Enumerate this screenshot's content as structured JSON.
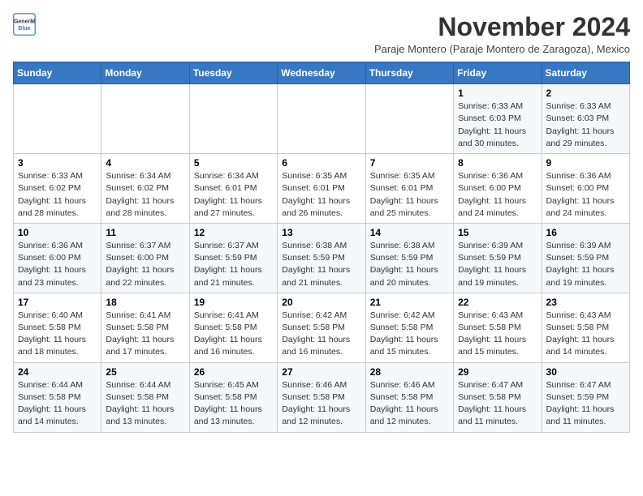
{
  "header": {
    "logo_line1": "General",
    "logo_line2": "Blue",
    "month_title": "November 2024",
    "subtitle": "Paraje Montero (Paraje Montero de Zaragoza), Mexico"
  },
  "days_of_week": [
    "Sunday",
    "Monday",
    "Tuesday",
    "Wednesday",
    "Thursday",
    "Friday",
    "Saturday"
  ],
  "weeks": [
    [
      {
        "day": "",
        "info": ""
      },
      {
        "day": "",
        "info": ""
      },
      {
        "day": "",
        "info": ""
      },
      {
        "day": "",
        "info": ""
      },
      {
        "day": "",
        "info": ""
      },
      {
        "day": "1",
        "info": "Sunrise: 6:33 AM\nSunset: 6:03 PM\nDaylight: 11 hours and 30 minutes."
      },
      {
        "day": "2",
        "info": "Sunrise: 6:33 AM\nSunset: 6:03 PM\nDaylight: 11 hours and 29 minutes."
      }
    ],
    [
      {
        "day": "3",
        "info": "Sunrise: 6:33 AM\nSunset: 6:02 PM\nDaylight: 11 hours and 28 minutes."
      },
      {
        "day": "4",
        "info": "Sunrise: 6:34 AM\nSunset: 6:02 PM\nDaylight: 11 hours and 28 minutes."
      },
      {
        "day": "5",
        "info": "Sunrise: 6:34 AM\nSunset: 6:01 PM\nDaylight: 11 hours and 27 minutes."
      },
      {
        "day": "6",
        "info": "Sunrise: 6:35 AM\nSunset: 6:01 PM\nDaylight: 11 hours and 26 minutes."
      },
      {
        "day": "7",
        "info": "Sunrise: 6:35 AM\nSunset: 6:01 PM\nDaylight: 11 hours and 25 minutes."
      },
      {
        "day": "8",
        "info": "Sunrise: 6:36 AM\nSunset: 6:00 PM\nDaylight: 11 hours and 24 minutes."
      },
      {
        "day": "9",
        "info": "Sunrise: 6:36 AM\nSunset: 6:00 PM\nDaylight: 11 hours and 24 minutes."
      }
    ],
    [
      {
        "day": "10",
        "info": "Sunrise: 6:36 AM\nSunset: 6:00 PM\nDaylight: 11 hours and 23 minutes."
      },
      {
        "day": "11",
        "info": "Sunrise: 6:37 AM\nSunset: 6:00 PM\nDaylight: 11 hours and 22 minutes."
      },
      {
        "day": "12",
        "info": "Sunrise: 6:37 AM\nSunset: 5:59 PM\nDaylight: 11 hours and 21 minutes."
      },
      {
        "day": "13",
        "info": "Sunrise: 6:38 AM\nSunset: 5:59 PM\nDaylight: 11 hours and 21 minutes."
      },
      {
        "day": "14",
        "info": "Sunrise: 6:38 AM\nSunset: 5:59 PM\nDaylight: 11 hours and 20 minutes."
      },
      {
        "day": "15",
        "info": "Sunrise: 6:39 AM\nSunset: 5:59 PM\nDaylight: 11 hours and 19 minutes."
      },
      {
        "day": "16",
        "info": "Sunrise: 6:39 AM\nSunset: 5:59 PM\nDaylight: 11 hours and 19 minutes."
      }
    ],
    [
      {
        "day": "17",
        "info": "Sunrise: 6:40 AM\nSunset: 5:58 PM\nDaylight: 11 hours and 18 minutes."
      },
      {
        "day": "18",
        "info": "Sunrise: 6:41 AM\nSunset: 5:58 PM\nDaylight: 11 hours and 17 minutes."
      },
      {
        "day": "19",
        "info": "Sunrise: 6:41 AM\nSunset: 5:58 PM\nDaylight: 11 hours and 16 minutes."
      },
      {
        "day": "20",
        "info": "Sunrise: 6:42 AM\nSunset: 5:58 PM\nDaylight: 11 hours and 16 minutes."
      },
      {
        "day": "21",
        "info": "Sunrise: 6:42 AM\nSunset: 5:58 PM\nDaylight: 11 hours and 15 minutes."
      },
      {
        "day": "22",
        "info": "Sunrise: 6:43 AM\nSunset: 5:58 PM\nDaylight: 11 hours and 15 minutes."
      },
      {
        "day": "23",
        "info": "Sunrise: 6:43 AM\nSunset: 5:58 PM\nDaylight: 11 hours and 14 minutes."
      }
    ],
    [
      {
        "day": "24",
        "info": "Sunrise: 6:44 AM\nSunset: 5:58 PM\nDaylight: 11 hours and 14 minutes."
      },
      {
        "day": "25",
        "info": "Sunrise: 6:44 AM\nSunset: 5:58 PM\nDaylight: 11 hours and 13 minutes."
      },
      {
        "day": "26",
        "info": "Sunrise: 6:45 AM\nSunset: 5:58 PM\nDaylight: 11 hours and 13 minutes."
      },
      {
        "day": "27",
        "info": "Sunrise: 6:46 AM\nSunset: 5:58 PM\nDaylight: 11 hours and 12 minutes."
      },
      {
        "day": "28",
        "info": "Sunrise: 6:46 AM\nSunset: 5:58 PM\nDaylight: 11 hours and 12 minutes."
      },
      {
        "day": "29",
        "info": "Sunrise: 6:47 AM\nSunset: 5:58 PM\nDaylight: 11 hours and 11 minutes."
      },
      {
        "day": "30",
        "info": "Sunrise: 6:47 AM\nSunset: 5:59 PM\nDaylight: 11 hours and 11 minutes."
      }
    ]
  ]
}
